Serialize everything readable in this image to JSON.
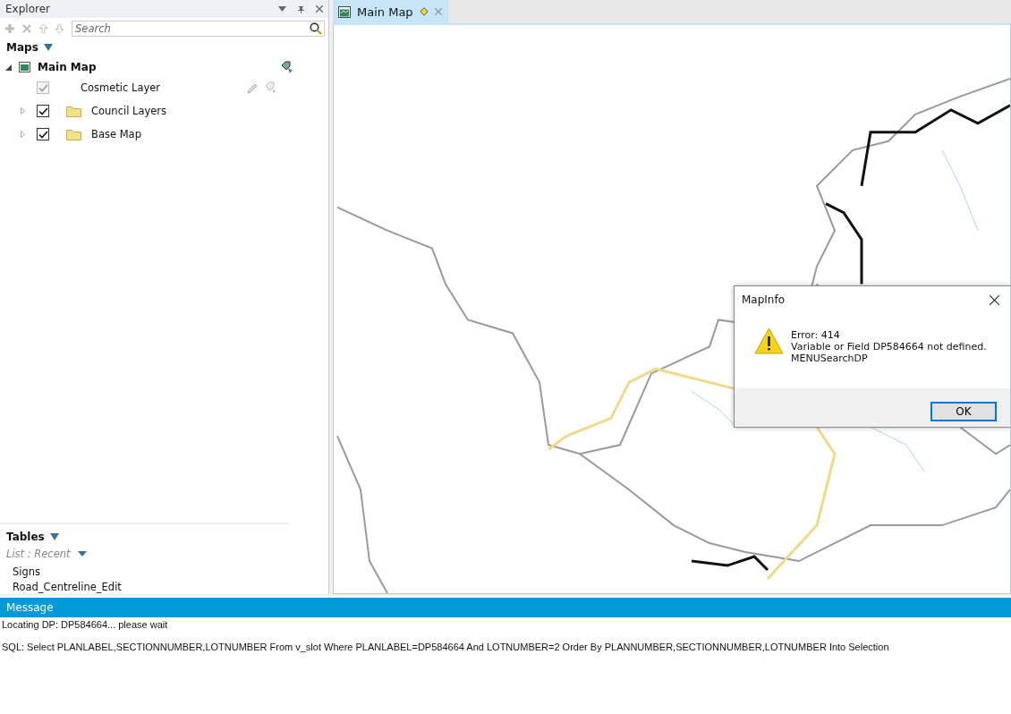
{
  "explorer": {
    "title": "Explorer",
    "search": {
      "placeholder": "Search"
    },
    "maps_heading": "Maps",
    "maps": [
      {
        "label": "Main Map",
        "expanded": true,
        "children": [
          {
            "kind": "cosmetic",
            "label": "Cosmetic Layer",
            "checked": true,
            "disabled": true
          },
          {
            "kind": "group",
            "label": "Council Layers",
            "checked": true,
            "disabled": false,
            "expanded": false
          },
          {
            "kind": "group",
            "label": "Base Map",
            "checked": true,
            "disabled": false,
            "expanded": false
          }
        ]
      }
    ],
    "tables_heading": "Tables",
    "list_filter": "List : Recent",
    "tables": [
      "Signs",
      "Road_Centreline_Edit"
    ]
  },
  "document_tabs": [
    {
      "label": "Main Map",
      "selected": true,
      "modified": true
    }
  ],
  "dialog": {
    "title": "MapInfo",
    "lines": [
      "Error: 414",
      "Variable or Field DP584664 not defined.",
      "MENUSearchDP"
    ],
    "buttons": [
      "OK"
    ]
  },
  "message_panel": {
    "title": "Message",
    "lines": [
      "Locating DP: DP584664... please wait",
      "SQL: Select PLANLABEL,SECTIONNUMBER,LOTNUMBER From v_slot Where PLANLABEL=DP584664 And LOTNUMBER=2 Order By PLANNUMBER,SECTIONNUMBER,LOTNUMBER Into Selection"
    ]
  }
}
